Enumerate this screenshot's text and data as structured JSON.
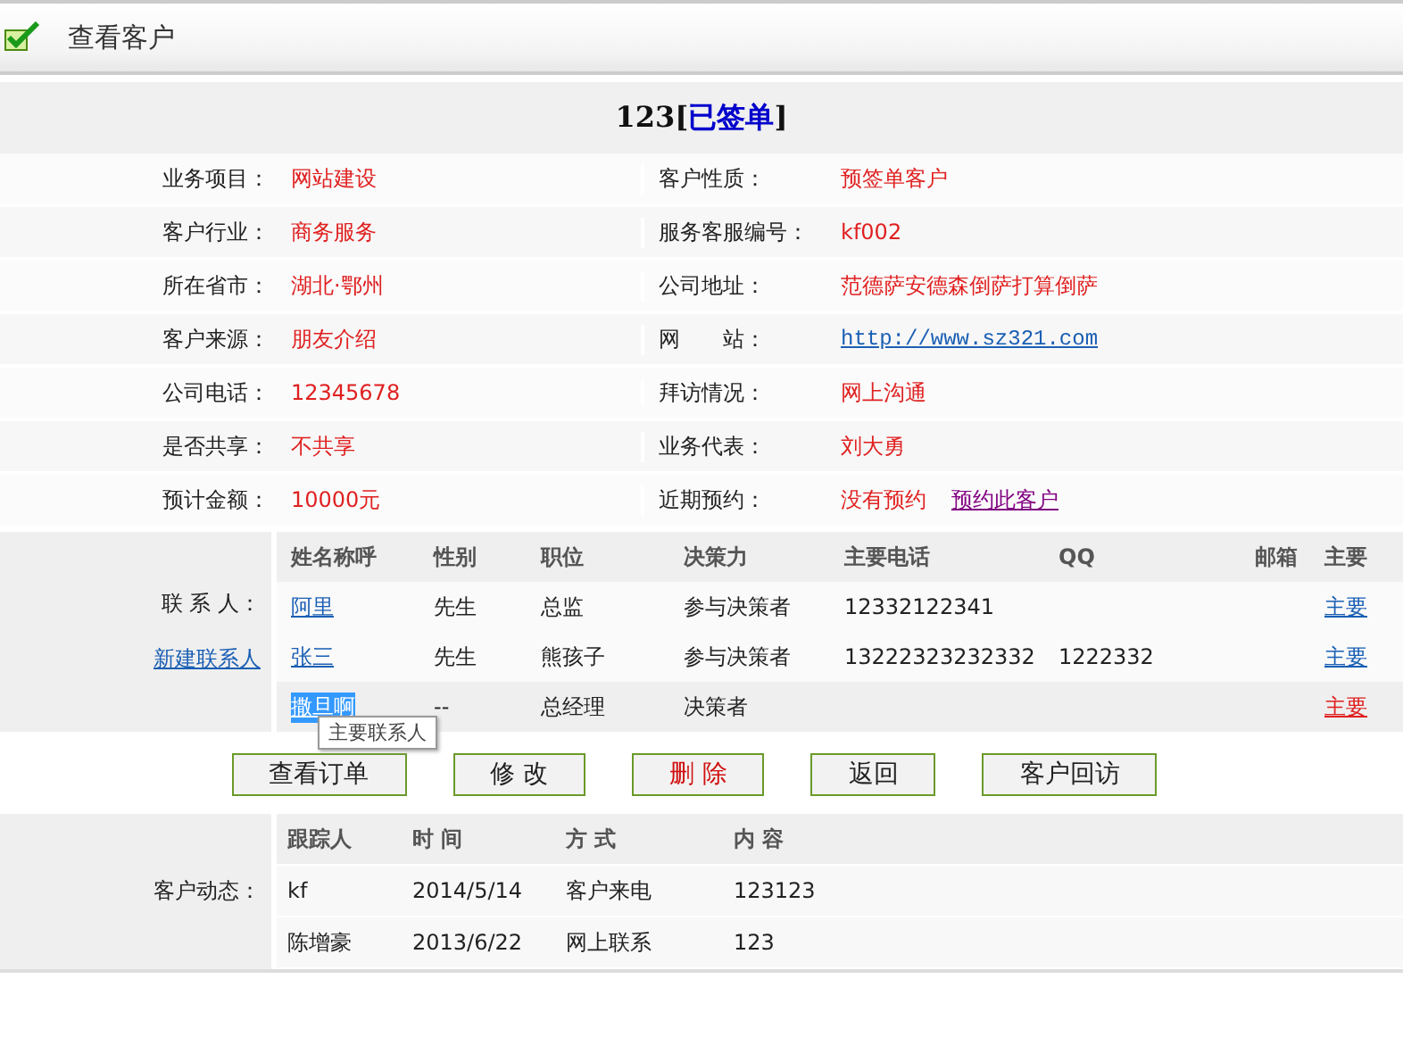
{
  "header": {
    "title": "查看客户"
  },
  "customer": {
    "name": "123",
    "open": "[",
    "status": "已签单",
    "close": "]"
  },
  "info_rows": [
    {
      "label": "业务项目：",
      "value": "网站建设",
      "label2": "客户性质：",
      "value2": "预签单客户"
    },
    {
      "label": "客户行业：",
      "value": "商务服务",
      "label2": "服务客服编号：",
      "value2": "kf002"
    },
    {
      "label": "所在省市：",
      "value": "湖北·鄂州",
      "label2": "公司地址：",
      "value2": "范德萨安德森倒萨打算倒萨"
    },
    {
      "label": "客户来源：",
      "value": "朋友介绍",
      "label2": "网　　站：",
      "value2": "http://www.sz321.com",
      "kind": "url"
    },
    {
      "label": "公司电话：",
      "value": "12345678",
      "label2": "拜访情况：",
      "value2": "网上沟通"
    },
    {
      "label": "是否共享：",
      "value": "不共享",
      "label2": "业务代表：",
      "value2": "刘大勇"
    },
    {
      "label": "预计金额：",
      "value": "10000元",
      "label2": "近期预约：",
      "value2": "没有预约",
      "link2": "预约此客户"
    }
  ],
  "contacts": {
    "label": "联 系 人：",
    "new_link": "新建联系人",
    "columns": [
      "姓名称呼",
      "性别",
      "职位",
      "决策力",
      "主要电话",
      "QQ",
      "邮箱",
      "主要"
    ],
    "rows": [
      {
        "name": "阿里",
        "gender": "先生",
        "position": "总监",
        "power": "参与决策者",
        "phone": "12332122341",
        "qq": "",
        "primary_link": "主要",
        "primary": false,
        "selected": false
      },
      {
        "name": "张三",
        "gender": "先生",
        "position": "熊孩子",
        "power": "参与决策者",
        "phone": "13222323232332",
        "qq": "1222332",
        "primary_link": "主要",
        "primary": false,
        "selected": false
      },
      {
        "name": "撒旦啊",
        "gender": "--",
        "position": "总经理",
        "power": "决策者",
        "phone": "",
        "qq": "",
        "primary_link": "主要",
        "primary": true,
        "selected": true
      }
    ],
    "tooltip": "主要联系人"
  },
  "buttons": [
    {
      "label": "查看订单",
      "kind": "normal"
    },
    {
      "label": "修 改",
      "kind": "normal"
    },
    {
      "label": "删 除",
      "kind": "danger"
    },
    {
      "label": "返回",
      "kind": "normal"
    },
    {
      "label": "客户回访",
      "kind": "normal"
    }
  ],
  "tracking": {
    "label": "客户动态：",
    "columns": [
      "跟踪人",
      "时 间",
      "方 式",
      "内 容"
    ],
    "rows": [
      [
        "kf",
        "2014/5/14",
        "客户来电",
        "123123"
      ],
      [
        "陈增豪",
        "2013/6/22",
        "网上联系",
        "123"
      ]
    ]
  }
}
